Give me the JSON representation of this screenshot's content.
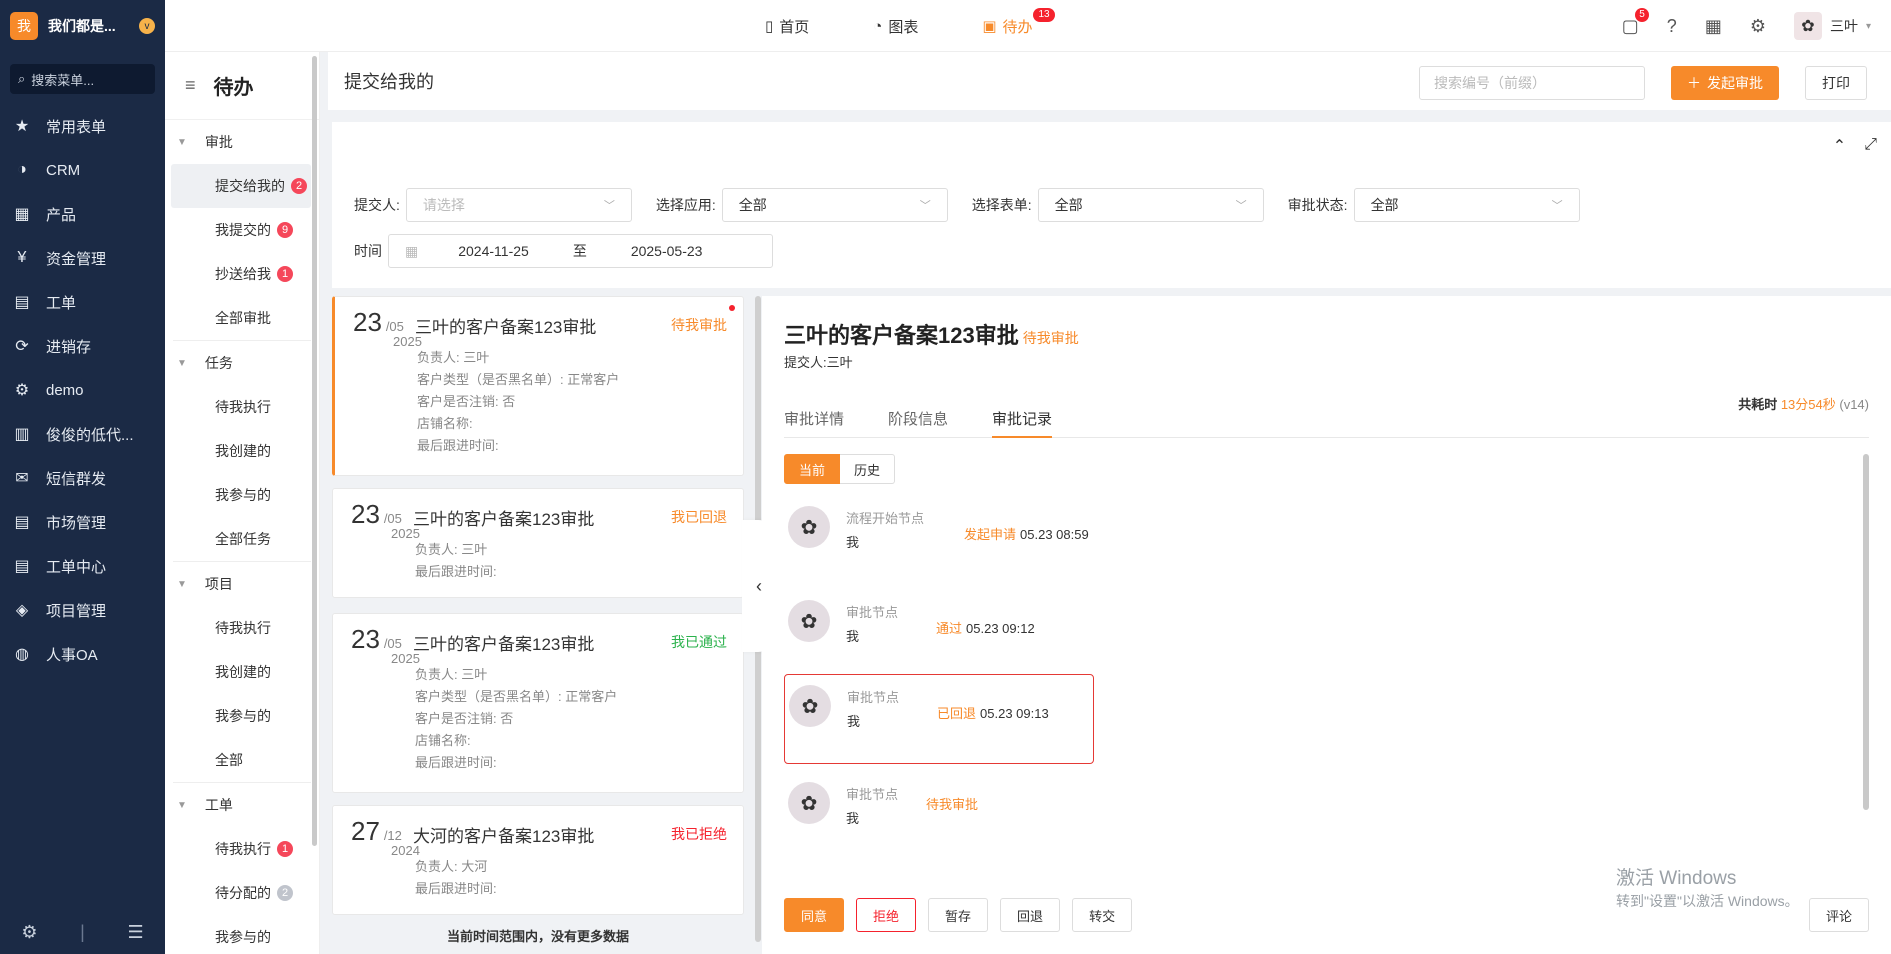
{
  "brand": {
    "logo_text": "我",
    "name": "我们都是...",
    "badge": "v"
  },
  "search_menu": {
    "placeholder": "搜索菜单..."
  },
  "nav": [
    {
      "label": "常用表单",
      "icon": "star-icon",
      "glyph": "★"
    },
    {
      "label": "CRM",
      "icon": "pie-icon",
      "glyph": "◑"
    },
    {
      "label": "产品",
      "icon": "boxes-icon",
      "glyph": "▦"
    },
    {
      "label": "资金管理",
      "icon": "money-icon",
      "glyph": "¥"
    },
    {
      "label": "工单",
      "icon": "clipboard-icon",
      "glyph": "▤"
    },
    {
      "label": "进销存",
      "icon": "cycle-icon",
      "glyph": "⟳"
    },
    {
      "label": "demo",
      "icon": "gear-icon",
      "glyph": "⚙"
    },
    {
      "label": "俊俊的低代...",
      "icon": "chart-icon",
      "glyph": "▥"
    },
    {
      "label": "短信群发",
      "icon": "mail-icon",
      "glyph": "✉"
    },
    {
      "label": "市场管理",
      "icon": "clipboard-icon",
      "glyph": "▤"
    },
    {
      "label": "工单中心",
      "icon": "clipboard-icon",
      "glyph": "▤"
    },
    {
      "label": "项目管理",
      "icon": "layers-icon",
      "glyph": "◈"
    },
    {
      "label": "人事OA",
      "icon": "globe-icon",
      "glyph": "◍"
    }
  ],
  "topbar": {
    "tabs": [
      {
        "label": "首页",
        "icon": "home-icon",
        "glyph": "▯",
        "badge": ""
      },
      {
        "label": "图表",
        "icon": "chart-icon",
        "glyph": "◔",
        "badge": ""
      },
      {
        "label": "待办",
        "icon": "calendar-icon",
        "glyph": "▣",
        "badge": "13"
      }
    ],
    "message_badge": "5",
    "user_name": "三叶"
  },
  "sub": {
    "title": "待办",
    "groups": [
      {
        "label": "审批",
        "items": [
          {
            "label": "提交给我的",
            "count": "2"
          },
          {
            "label": "我提交的",
            "count": "9"
          },
          {
            "label": "抄送给我",
            "count": "1"
          },
          {
            "label": "全部审批",
            "count": ""
          }
        ]
      },
      {
        "label": "任务",
        "items": [
          {
            "label": "待我执行",
            "count": ""
          },
          {
            "label": "我创建的",
            "count": ""
          },
          {
            "label": "我参与的",
            "count": ""
          },
          {
            "label": "全部任务",
            "count": ""
          }
        ]
      },
      {
        "label": "项目",
        "items": [
          {
            "label": "待我执行",
            "count": ""
          },
          {
            "label": "我创建的",
            "count": ""
          },
          {
            "label": "我参与的",
            "count": ""
          },
          {
            "label": "全部",
            "count": ""
          }
        ]
      },
      {
        "label": "工单",
        "items": [
          {
            "label": "待我执行",
            "count": "1"
          },
          {
            "label": "待分配的",
            "count": "2"
          },
          {
            "label": "我参与的",
            "count": ""
          }
        ]
      }
    ]
  },
  "main": {
    "title": "提交给我的",
    "search_placeholder": "搜索编号（前缀）",
    "start_btn": "发起审批",
    "print_btn": "打印"
  },
  "filters": {
    "submitter_label": "提交人:",
    "submitter_placeholder": "请选择",
    "app_label": "选择应用:",
    "app_value": "全部",
    "form_label": "选择表单:",
    "form_value": "全部",
    "status_label": "审批状态:",
    "status_value": "全部",
    "time_label": "时间",
    "date_from": "2024-11-25",
    "date_sep": "至",
    "date_to": "2025-05-23"
  },
  "list": {
    "cards": [
      {
        "day": "23",
        "month": "/05",
        "year": "2025",
        "title": "三叶的客户备案123审批",
        "status": "待我审批",
        "fields": [
          "负责人: 三叶",
          "客户类型（是否黑名单）: 正常客户",
          "客户是否注销: 否",
          "店铺名称:",
          "最后跟进时间:"
        ]
      },
      {
        "day": "23",
        "month": "/05",
        "year": "2025",
        "title": "三叶的客户备案123审批",
        "status": "我已回退",
        "fields": [
          "负责人: 三叶",
          "最后跟进时间:"
        ]
      },
      {
        "day": "23",
        "month": "/05",
        "year": "2025",
        "title": "三叶的客户备案123审批",
        "status": "我已通过",
        "fields": [
          "负责人: 三叶",
          "客户类型（是否黑名单）: 正常客户",
          "客户是否注销: 否",
          "店铺名称:",
          "最后跟进时间:"
        ]
      },
      {
        "day": "27",
        "month": "/12",
        "year": "2024",
        "title": "大河的客户备案123审批",
        "status": "我已拒绝",
        "fields": [
          "负责人: 大河",
          "最后跟进时间:"
        ]
      }
    ],
    "footer": "当前时间范围内，没有更多数据"
  },
  "detail": {
    "title": "三叶的客户备案123审批",
    "status": "待我审批",
    "submitter": "提交人:三叶",
    "time_label": "共耗时",
    "time_value": "13分54秒",
    "version": "(v14)",
    "tabs": [
      "审批详情",
      "阶段信息",
      "审批记录"
    ],
    "seg_current": "当前",
    "seg_history": "历史",
    "timeline": [
      {
        "node": "流程开始节点",
        "who": "我",
        "action": "发起申请",
        "time": "05.23 08:59"
      },
      {
        "node": "审批节点",
        "who": "我",
        "action": "通过",
        "time": "05.23 09:12"
      },
      {
        "node": "审批节点",
        "who": "我",
        "action": "已回退",
        "time": "05.23 09:13"
      },
      {
        "node": "审批节点",
        "who": "我",
        "action": "待我审批",
        "time": ""
      }
    ],
    "actions": {
      "agree": "同意",
      "reject": "拒绝",
      "save": "暂存",
      "back": "回退",
      "transfer": "转交",
      "comment": "评论"
    }
  },
  "watermark": {
    "line1": "激活 Windows",
    "line2": "转到\"设置\"以激活 Windows。"
  },
  "colors": {
    "accent": "#f78a2a",
    "sidebar": "#1b2a45",
    "danger": "#f5222d",
    "success": "#2bb24c"
  }
}
